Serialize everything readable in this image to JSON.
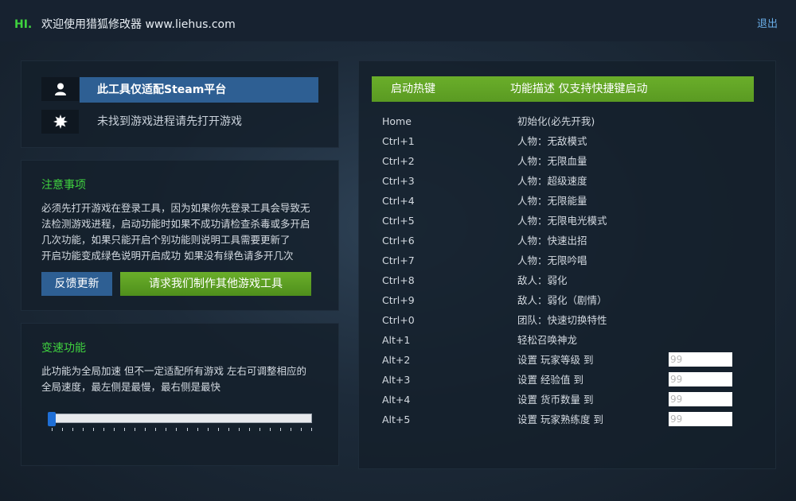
{
  "header": {
    "hi": "HI.",
    "welcome": "欢迎使用猎狐修改器 www.liehus.com",
    "logout": "退出"
  },
  "platform": {
    "banner": "此工具仅适配Steam平台",
    "status": "未找到游戏进程请先打开游戏"
  },
  "notice": {
    "title": "注意事项",
    "lines": [
      "必须先打开游戏在登录工具，因为如果你先登录工具会导致无",
      "法检测游戏进程，启动功能时如果不成功请检查杀毒或多开启",
      "几次功能，如果只能开启个别功能则说明工具需要更新了",
      "开启功能变成绿色说明开启成功 如果没有绿色请多开几次"
    ],
    "feedback_button": "反馈更新",
    "request_button": "请求我们制作其他游戏工具"
  },
  "speed": {
    "title": "变速功能",
    "lines": [
      "此功能为全局加速 但不一定适配所有游戏 左右可调整相应的",
      "全局速度，最左侧是最慢，最右侧是最快"
    ],
    "slider_value": 0
  },
  "hotkeys": {
    "col_key": "启动热键",
    "col_desc": "功能描述 仅支持快捷键启动",
    "rows": [
      {
        "key": "Home",
        "desc": "初始化(必先开我)"
      },
      {
        "key": "Ctrl+1",
        "desc": "人物：无敌模式"
      },
      {
        "key": "Ctrl+2",
        "desc": "人物：无限血量"
      },
      {
        "key": "Ctrl+3",
        "desc": "人物：超级速度"
      },
      {
        "key": "Ctrl+4",
        "desc": "人物：无限能量"
      },
      {
        "key": "Ctrl+5",
        "desc": "人物：无限电光模式"
      },
      {
        "key": "Ctrl+6",
        "desc": "人物：快速出招"
      },
      {
        "key": "Ctrl+7",
        "desc": "人物：无限吟唱"
      },
      {
        "key": "Ctrl+8",
        "desc": "敌人：弱化"
      },
      {
        "key": "Ctrl+9",
        "desc": "敌人：弱化（剧情）"
      },
      {
        "key": "Ctrl+0",
        "desc": "团队：快速切换特性"
      },
      {
        "key": "Alt+1",
        "desc": "轻松召唤神龙"
      },
      {
        "key": "Alt+2",
        "desc": "设置 玩家等级 到",
        "placeholder": "99"
      },
      {
        "key": "Alt+3",
        "desc": "设置 经验值 到",
        "placeholder": "99"
      },
      {
        "key": "Alt+4",
        "desc": "设置 货币数量 到",
        "placeholder": "99"
      },
      {
        "key": "Alt+5",
        "desc": "设置 玩家熟练度 到",
        "placeholder": "99"
      }
    ]
  },
  "colors": {
    "accent_green": "#6aae2a",
    "accent_blue": "#2e5f93",
    "title_green": "#3fd23f",
    "link_blue": "#6aaee8"
  },
  "icons": {
    "platform": "user-icon",
    "status": "gear-icon"
  }
}
